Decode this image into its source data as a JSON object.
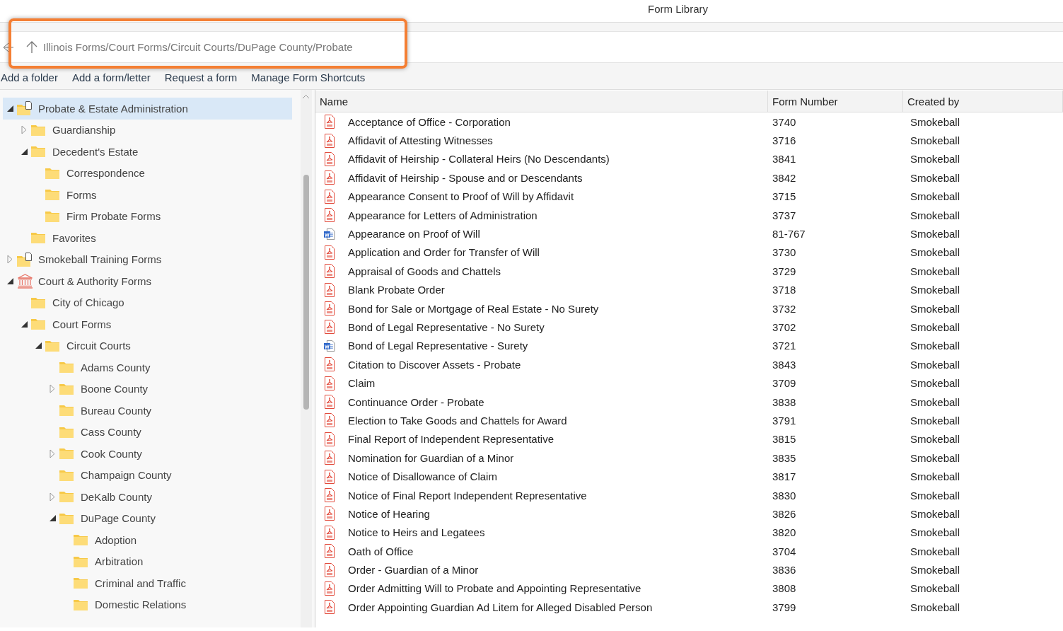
{
  "window": {
    "title": "Form Library"
  },
  "address_bar": {
    "path": "Illinois Forms/Court Forms/Circuit Courts/DuPage County/Probate",
    "highlighted": true
  },
  "toolbar": [
    "Add a folder",
    "Add a form/letter",
    "Request a form",
    "Manage Form Shortcuts"
  ],
  "tree": [
    {
      "label": "Probate & Estate Administration",
      "kind": "shared",
      "expanded": true,
      "selected": true,
      "children": [
        {
          "label": "Guardianship",
          "kind": "folder",
          "expanded": false,
          "selected": false
        },
        {
          "label": "Decedent's Estate",
          "kind": "folder",
          "expanded": true,
          "selected": false,
          "children": [
            {
              "label": "Correspondence",
              "kind": "folder",
              "selected": false
            },
            {
              "label": "Forms",
              "kind": "folder",
              "selected": false
            },
            {
              "label": "Firm Probate Forms",
              "kind": "folder",
              "selected": false
            }
          ]
        },
        {
          "label": "Favorites",
          "kind": "folder",
          "selected": false
        }
      ]
    },
    {
      "label": "Smokeball Training Forms",
      "kind": "shared",
      "expanded": false,
      "selected": false
    },
    {
      "label": "Court & Authority Forms",
      "kind": "court",
      "expanded": true,
      "selected": false,
      "children": [
        {
          "label": "City of Chicago",
          "kind": "folder",
          "selected": false
        },
        {
          "label": "Court Forms",
          "kind": "folder",
          "expanded": true,
          "selected": false,
          "children": [
            {
              "label": "Circuit Courts",
              "kind": "folder",
              "expanded": true,
              "selected": false,
              "children": [
                {
                  "label": "Adams County",
                  "kind": "folder",
                  "selected": false
                },
                {
                  "label": "Boone County",
                  "kind": "folder",
                  "expanded": false,
                  "selected": false
                },
                {
                  "label": "Bureau County",
                  "kind": "folder",
                  "selected": false
                },
                {
                  "label": "Cass County",
                  "kind": "folder",
                  "selected": false
                },
                {
                  "label": "Cook County",
                  "kind": "folder",
                  "expanded": false,
                  "selected": false
                },
                {
                  "label": "Champaign County",
                  "kind": "folder",
                  "selected": false
                },
                {
                  "label": "DeKalb County",
                  "kind": "folder",
                  "expanded": false,
                  "selected": false
                },
                {
                  "label": "DuPage County",
                  "kind": "folder",
                  "expanded": true,
                  "selected": false,
                  "children": [
                    {
                      "label": "Adoption",
                      "kind": "folder",
                      "selected": false
                    },
                    {
                      "label": "Arbitration",
                      "kind": "folder",
                      "selected": false
                    },
                    {
                      "label": "Criminal and Traffic",
                      "kind": "folder",
                      "selected": false
                    },
                    {
                      "label": "Domestic Relations",
                      "kind": "folder",
                      "selected": false
                    }
                  ]
                }
              ]
            }
          ]
        }
      ]
    }
  ],
  "table": {
    "columns": [
      "Name",
      "Form Number",
      "Created by"
    ],
    "rows": [
      {
        "kind": "pdf",
        "name": "Acceptance of Office - Corporation",
        "number": "3740",
        "created_by": "Smokeball"
      },
      {
        "kind": "pdf",
        "name": "Affidavit of Attesting Witnesses",
        "number": "3716",
        "created_by": "Smokeball"
      },
      {
        "kind": "pdf",
        "name": "Affidavit of Heirship - Collateral Heirs (No Descendants)",
        "number": "3841",
        "created_by": "Smokeball"
      },
      {
        "kind": "pdf",
        "name": "Affidavit of Heirship - Spouse and or Descendants",
        "number": "3842",
        "created_by": "Smokeball"
      },
      {
        "kind": "pdf",
        "name": "Appearance Consent to Proof of Will by Affidavit",
        "number": "3715",
        "created_by": "Smokeball"
      },
      {
        "kind": "pdf",
        "name": "Appearance for Letters of Administration",
        "number": "3737",
        "created_by": "Smokeball"
      },
      {
        "kind": "word",
        "name": "Appearance on Proof of Will",
        "number": "81-767",
        "created_by": "Smokeball"
      },
      {
        "kind": "pdf",
        "name": "Application and Order for Transfer of Will",
        "number": "3730",
        "created_by": "Smokeball"
      },
      {
        "kind": "pdf",
        "name": "Appraisal of Goods and Chattels",
        "number": "3729",
        "created_by": "Smokeball"
      },
      {
        "kind": "pdf",
        "name": "Blank Probate Order",
        "number": "3718",
        "created_by": "Smokeball"
      },
      {
        "kind": "pdf",
        "name": "Bond for Sale or Mortgage of Real Estate - No Surety",
        "number": "3732",
        "created_by": "Smokeball"
      },
      {
        "kind": "pdf",
        "name": "Bond of Legal Representative - No Surety",
        "number": "3702",
        "created_by": "Smokeball"
      },
      {
        "kind": "word",
        "name": "Bond of Legal Representative - Surety",
        "number": "3721",
        "created_by": "Smokeball"
      },
      {
        "kind": "pdf",
        "name": "Citation to Discover Assets - Probate",
        "number": "3843",
        "created_by": "Smokeball"
      },
      {
        "kind": "pdf",
        "name": "Claim",
        "number": "3709",
        "created_by": "Smokeball"
      },
      {
        "kind": "pdf",
        "name": "Continuance Order - Probate",
        "number": "3838",
        "created_by": "Smokeball"
      },
      {
        "kind": "pdf",
        "name": "Election to Take Goods and Chattels for Award",
        "number": "3791",
        "created_by": "Smokeball"
      },
      {
        "kind": "pdf",
        "name": "Final Report of Independent Representative",
        "number": "3815",
        "created_by": "Smokeball"
      },
      {
        "kind": "pdf",
        "name": "Nomination for Guardian of a Minor",
        "number": "3835",
        "created_by": "Smokeball"
      },
      {
        "kind": "pdf",
        "name": "Notice of Disallowance of Claim",
        "number": "3817",
        "created_by": "Smokeball"
      },
      {
        "kind": "pdf",
        "name": "Notice of Final Report Independent Representative",
        "number": "3830",
        "created_by": "Smokeball"
      },
      {
        "kind": "pdf",
        "name": "Notice of Hearing",
        "number": "3826",
        "created_by": "Smokeball"
      },
      {
        "kind": "pdf",
        "name": "Notice to Heirs and Legatees",
        "number": "3820",
        "created_by": "Smokeball"
      },
      {
        "kind": "pdf",
        "name": "Oath of Office",
        "number": "3704",
        "created_by": "Smokeball"
      },
      {
        "kind": "pdf",
        "name": "Order - Guardian of a Minor",
        "number": "3836",
        "created_by": "Smokeball"
      },
      {
        "kind": "pdf",
        "name": "Order Admitting Will to Probate and Appointing Representative",
        "number": "3808",
        "created_by": "Smokeball"
      },
      {
        "kind": "pdf",
        "name": "Order Appointing Guardian Ad Litem for Alleged Disabled Person",
        "number": "3799",
        "created_by": "Smokeball"
      }
    ]
  }
}
